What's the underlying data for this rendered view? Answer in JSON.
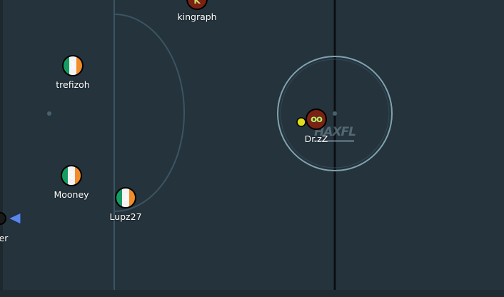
{
  "game": {
    "logo_text": "HAXFL",
    "players": [
      {
        "id": "kingraph",
        "name": "kingraph",
        "avatar": "K"
      },
      {
        "id": "trefizoh",
        "name": "trefizoh",
        "avatar": "1"
      },
      {
        "id": "mooney",
        "name": "Mooney",
        "avatar": "2"
      },
      {
        "id": "lupz27",
        "name": "Lupz27",
        "avatar": "3"
      },
      {
        "id": "drzz",
        "name": "Dr.zZ",
        "avatar": "oo"
      },
      {
        "id": "offscreen",
        "name": "er",
        "avatar": ""
      }
    ],
    "colors": {
      "field": "#25333c",
      "lines": "#3c5461",
      "halfway_line": "#0a0f12",
      "kickoff_circle": "#7fa3ad",
      "team_green": "#169b62",
      "team_white": "#f4f4f4",
      "team_orange": "#f28c28",
      "team_red_avatar": "#7a2214",
      "ball": "#e0dc1a",
      "pointer": "#5a86e6"
    }
  }
}
